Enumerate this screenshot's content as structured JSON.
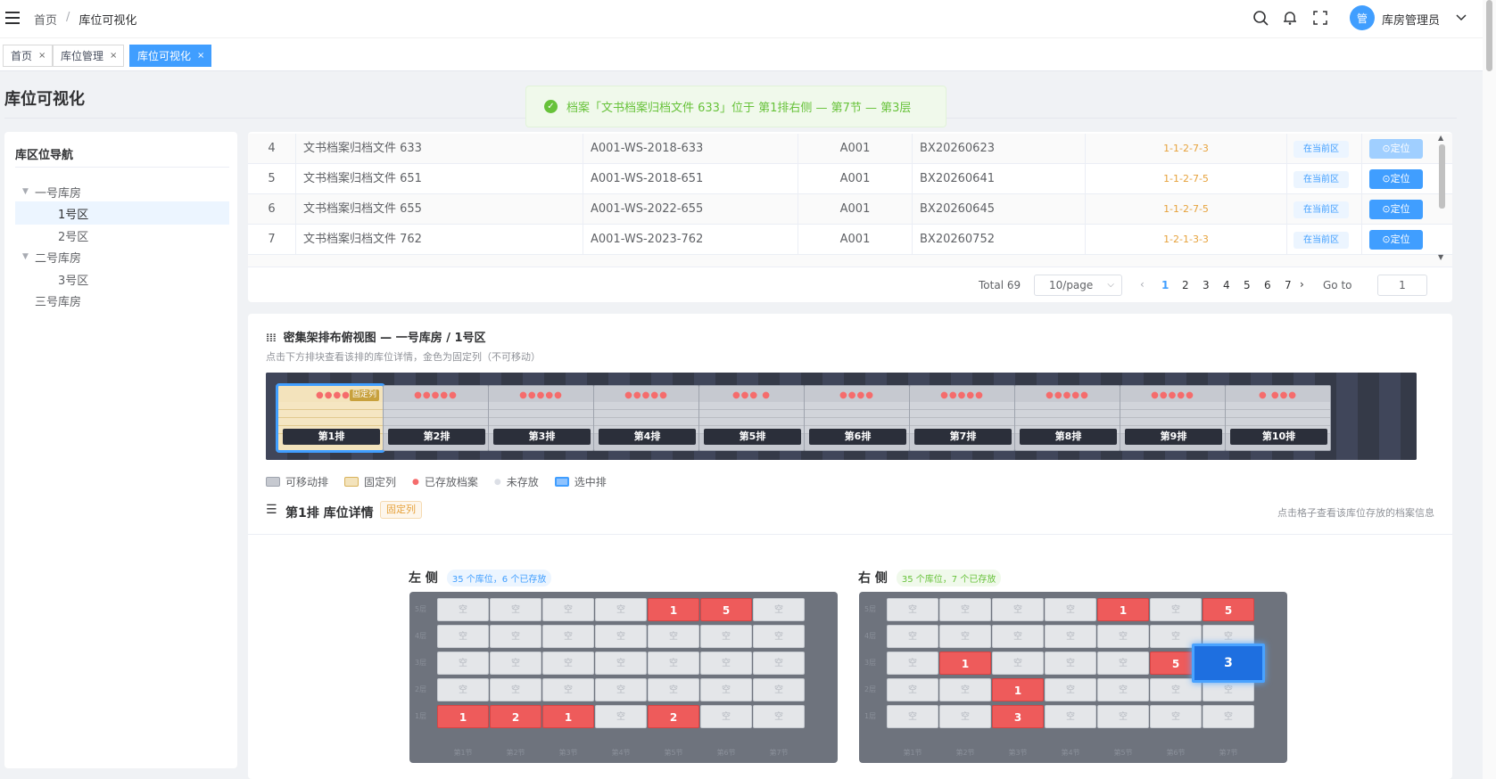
{
  "header": {
    "breadcrumb": [
      "首页",
      "库位可视化"
    ],
    "user_avatar": "管",
    "user_name": "库房管理员"
  },
  "tabs": [
    {
      "label": "首页",
      "active": false
    },
    {
      "label": "库位管理",
      "active": false
    },
    {
      "label": "库位可视化",
      "active": true
    }
  ],
  "page_title": "库位可视化",
  "toast": "档案「文书档案归档文件 633」位于 第1排右侧 — 第7节 — 第3层",
  "sidebar": {
    "title": "库区位导航",
    "tree": [
      {
        "label": "一号库房",
        "level": 0,
        "expanded": true
      },
      {
        "label": "1号区",
        "level": 1,
        "selected": true
      },
      {
        "label": "2号区",
        "level": 1
      },
      {
        "label": "二号库房",
        "level": 0,
        "expanded": true
      },
      {
        "label": "3号区",
        "level": 1
      },
      {
        "label": "三号库房",
        "level": 0
      }
    ]
  },
  "table": {
    "rows": [
      {
        "no": "4",
        "name": "文书档案归档文件 633",
        "code": "A001-WS-2018-633",
        "room": "A001",
        "box": "BX20260623",
        "loc": "1-1-2-7-3",
        "zone": "在当前区",
        "action": "⊙定位"
      },
      {
        "no": "5",
        "name": "文书档案归档文件 651",
        "code": "A001-WS-2018-651",
        "room": "A001",
        "box": "BX20260641",
        "loc": "1-1-2-7-5",
        "zone": "在当前区",
        "action": "⊙定位"
      },
      {
        "no": "6",
        "name": "文书档案归档文件 655",
        "code": "A001-WS-2022-655",
        "room": "A001",
        "box": "BX20260645",
        "loc": "1-1-2-7-5",
        "zone": "在当前区",
        "action": "⊙定位"
      },
      {
        "no": "7",
        "name": "文书档案归档文件 762",
        "code": "A001-WS-2023-762",
        "room": "A001",
        "box": "BX20260752",
        "loc": "1-2-1-3-3",
        "zone": "在当前区",
        "action": "⊙定位"
      }
    ],
    "pagination": {
      "total": "Total 69",
      "page_size": "10/page",
      "pages": [
        "1",
        "2",
        "3",
        "4",
        "5",
        "6",
        "7"
      ],
      "current": "1",
      "goto_label": "Go to",
      "goto_value": "1"
    }
  },
  "shelf_view": {
    "title": "密集架排布俯视图 — 一号库房 / 1号区",
    "subtitle": "点击下方排块查看该排的库位详情，金色为固定列（不可移动）",
    "fixed_tag": "固定列",
    "rows": [
      {
        "label": "第1排",
        "dots": "●●●●●",
        "fixed": true,
        "selected": true
      },
      {
        "label": "第2排",
        "dots": "●●●●●"
      },
      {
        "label": "第3排",
        "dots": "●●●●●"
      },
      {
        "label": "第4排",
        "dots": "●●●●●"
      },
      {
        "label": "第5排",
        "dots": "●●● ●"
      },
      {
        "label": "第6排",
        "dots": "●●●●"
      },
      {
        "label": "第7排",
        "dots": "●●●●●"
      },
      {
        "label": "第8排",
        "dots": "●●●●●"
      },
      {
        "label": "第9排",
        "dots": "●●●●●"
      },
      {
        "label": "第10排",
        "dots": "● ●●●"
      }
    ],
    "legend": [
      "可移动排",
      "固定列",
      "已存放档案",
      "未存放",
      "选中排"
    ]
  },
  "detail": {
    "title": "第1排 库位详情",
    "tag": "固定列",
    "hint": "点击格子查看该库位存放的档案信息",
    "empty_label": "空",
    "layer_labels": [
      "5层",
      "4层",
      "3层",
      "2层",
      "1层"
    ],
    "section_labels": [
      "第1节",
      "第2节",
      "第3节",
      "第4节",
      "第5节",
      "第6节",
      "第7节"
    ],
    "left": {
      "title": "左 侧",
      "badge": "35 个库位，6 个已存放",
      "grid": [
        [
          "",
          "",
          "",
          "",
          "1",
          "5",
          ""
        ],
        [
          "",
          "",
          "",
          "",
          "",
          "",
          ""
        ],
        [
          "",
          "",
          "",
          "",
          "",
          "",
          ""
        ],
        [
          "",
          "",
          "",
          "",
          "",
          "",
          ""
        ],
        [
          "1",
          "2",
          "1",
          "",
          "2",
          "",
          ""
        ]
      ]
    },
    "right": {
      "title": "右 侧",
      "badge": "35 个库位，7 个已存放",
      "grid": [
        [
          "",
          "",
          "",
          "",
          "1",
          "",
          "5"
        ],
        [
          "",
          "",
          "",
          "",
          "",
          "",
          ""
        ],
        [
          "",
          "1",
          "",
          "",
          "",
          "5",
          "3"
        ],
        [
          "",
          "",
          "1",
          "",
          "",
          "",
          ""
        ],
        [
          "",
          "",
          "3",
          "",
          "",
          "",
          ""
        ]
      ],
      "highlight": [
        2,
        6
      ]
    }
  },
  "colors": {
    "primary": "#409eff",
    "stored": "#ee5b5b",
    "fixed": "#f3e3bc",
    "success": "#67c23a",
    "warning": "#e6a23c"
  }
}
